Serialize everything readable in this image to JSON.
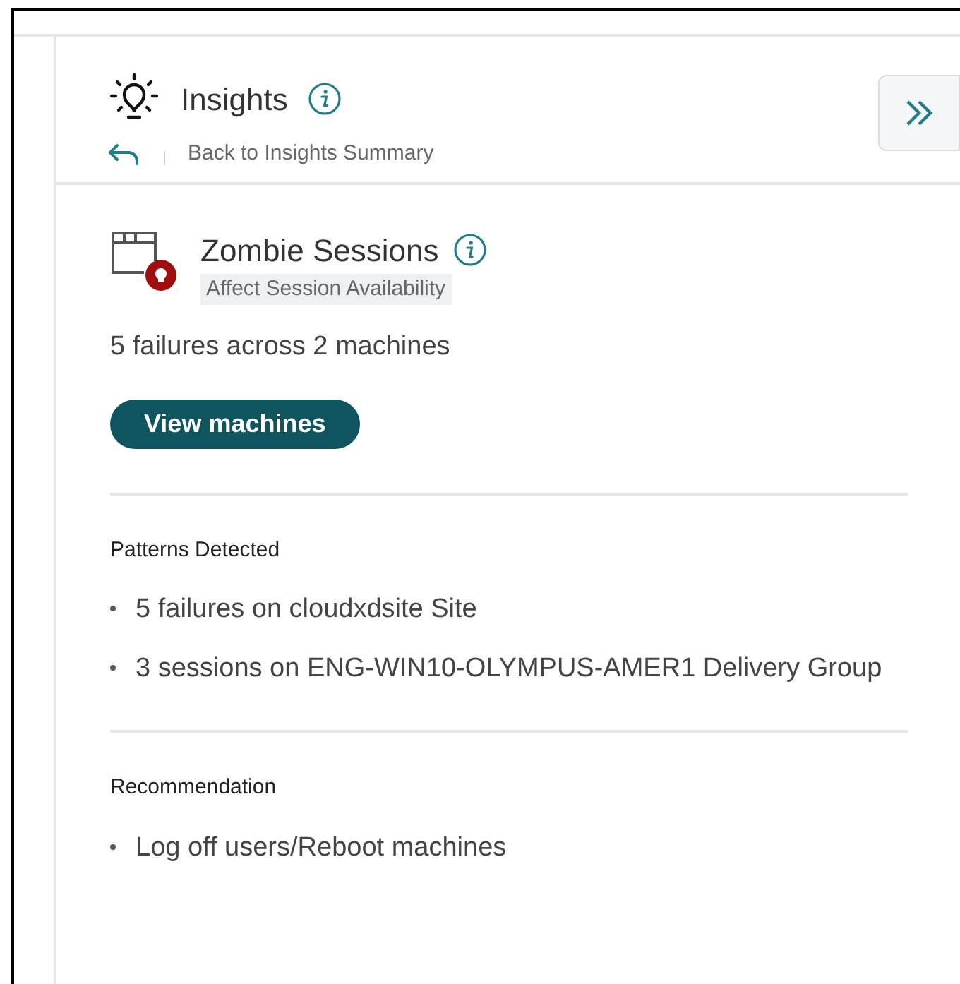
{
  "header": {
    "title": "Insights",
    "back_link": "Back to Insights Summary"
  },
  "insight": {
    "title": "Zombie Sessions",
    "tag": "Affect Session Availability",
    "summary": "5 failures across 2 machines",
    "action": "View machines"
  },
  "sections": [
    {
      "heading": "Patterns Detected",
      "items": [
        "5 failures on cloudxdsite Site",
        "3 sessions on ENG-WIN10-OLYMPUS-AMER1 Delivery Group"
      ]
    },
    {
      "heading": "Recommendation",
      "items": [
        "Log off users/Reboot machines"
      ]
    }
  ]
}
